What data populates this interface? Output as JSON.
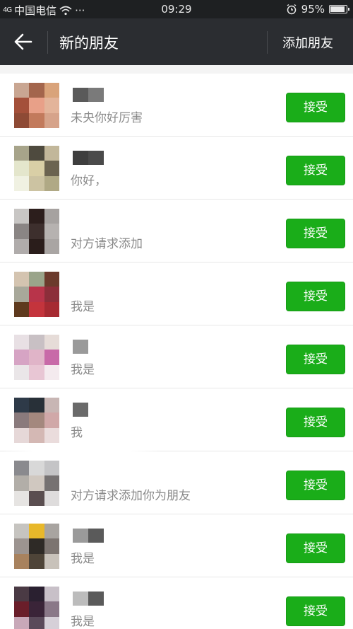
{
  "status_bar": {
    "carrier": "中国电信",
    "dots": "···",
    "time": "09:29",
    "battery": "95%",
    "signal_label": "4G"
  },
  "nav": {
    "title": "新的朋友",
    "add_friend_label": "添加朋友",
    "background": "#2b2d31"
  },
  "accept_color": "#1aad19",
  "requests": [
    {
      "message": "未央你好厉害",
      "accept_label": "接受",
      "avatar_colors": [
        "#c9a692",
        "#a3654c",
        "#d9a37a",
        "#a4503a",
        "#e8a088",
        "#e3b49a",
        "#8e4a35",
        "#c27a5c",
        "#d6a38a"
      ],
      "name_blur": [
        "#5a5a5a",
        "#7a7a7a"
      ]
    },
    {
      "message": "你好，",
      "accept_label": "接受",
      "avatar_colors": [
        "#a7a48a",
        "#4e4a3e",
        "#c2b79a",
        "#e4e6cc",
        "#d9cfa6",
        "#6b6350",
        "#f0f1e2",
        "#ccc3a2",
        "#b0a985"
      ],
      "name_blur": [
        "#3e3e3e",
        "#4a4a4a"
      ]
    },
    {
      "message": "对方请求添加",
      "accept_label": "接受",
      "avatar_colors": [
        "#c8c6c4",
        "#2c1e1c",
        "#a6a2a0",
        "#8a8584",
        "#3d2f2d",
        "#b6b2b0",
        "#b0acab",
        "#2a1d1b",
        "#a9a5a3"
      ],
      "name_blur": []
    },
    {
      "message": "我是",
      "accept_label": "接受",
      "avatar_colors": [
        "#d4c4b0",
        "#9aa48a",
        "#6b3a2c",
        "#a8a89a",
        "#b8344a",
        "#8c2e3a",
        "#5e3a1e",
        "#c4343c",
        "#a62a32"
      ],
      "name_blur": []
    },
    {
      "message": "我是",
      "accept_label": "接受",
      "avatar_colors": [
        "#e8e0e4",
        "#c8c0c4",
        "#e6dcd8",
        "#d6a4c4",
        "#e0b4c8",
        "#c86aa8",
        "#eae6e8",
        "#e8c6d4",
        "#f4eaee"
      ],
      "name_blur": [
        "#9a9a9a"
      ]
    },
    {
      "message": "我",
      "accept_label": "接受",
      "avatar_colors": [
        "#2e3a48",
        "#283038",
        "#c8b6b4",
        "#8a7a7c",
        "#a4887e",
        "#d0a8a8",
        "#e6d8d8",
        "#d4b8b4",
        "#eadcdc"
      ],
      "name_blur": [
        "#6a6a6a"
      ]
    },
    {
      "message": "对方请求添加你为朋友",
      "accept_label": "接受",
      "avatar_colors": [
        "#8a8a8e",
        "#d8d8d8",
        "#c4c4c6",
        "#b2aea8",
        "#d0c8c0",
        "#767272",
        "#e6e4e2",
        "#5a4e50",
        "#dedcdc"
      ],
      "name_blur": []
    },
    {
      "message": "我是",
      "accept_label": "接受",
      "avatar_colors": [
        "#c6c4c0",
        "#e8b82a",
        "#a8a4a0",
        "#9c9490",
        "#2e2a26",
        "#7c7470",
        "#a8825e",
        "#4e4438",
        "#c8c2ba"
      ],
      "name_blur": [
        "#9a9a9a",
        "#5a5a5a"
      ]
    },
    {
      "message": "我是",
      "accept_label": "接受",
      "avatar_colors": [
        "#4a3a44",
        "#2a2030",
        "#c8c0c8",
        "#6a1e2a",
        "#3a2438",
        "#8a7888",
        "#c8a8b8",
        "#5a4a5a",
        "#d6d0d8"
      ],
      "name_blur": [
        "#bcbcbc",
        "#5a5a5a"
      ]
    }
  ]
}
